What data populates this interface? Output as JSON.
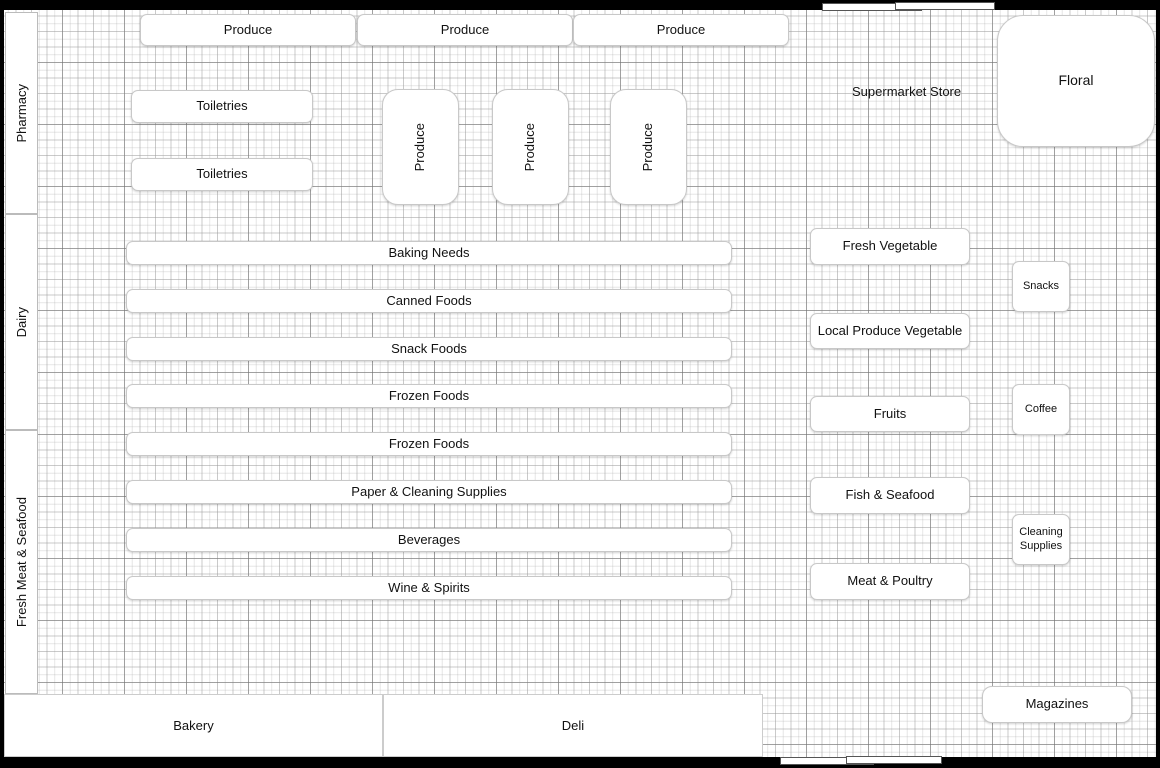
{
  "title": "Supermarket Store",
  "produce_top": [
    "Produce",
    "Produce",
    "Produce"
  ],
  "toiletries": [
    "Toiletries",
    "Toiletries"
  ],
  "produce_vertical": [
    "Produce",
    "Produce",
    "Produce"
  ],
  "aisles": [
    "Baking Needs",
    "Canned Foods",
    "Snack Foods",
    "Frozen Foods",
    "Frozen Foods",
    "Paper & Cleaning Supplies",
    "Beverages",
    "Wine & Spirits"
  ],
  "center_sections": [
    "Fresh Vegetable",
    "Local Produce Vegetable",
    "Fruits",
    "Fish & Seafood",
    "Meat & Poultry"
  ],
  "right_small": [
    "Snacks",
    "Coffee",
    "Cleaning Supplies"
  ],
  "left_walls": [
    "Pharmacy",
    "Dairy",
    "Fresh Meat & Seafood"
  ],
  "bottom": [
    "Bakery",
    "Deli"
  ],
  "floral": "Floral",
  "magazines": "Magazines"
}
